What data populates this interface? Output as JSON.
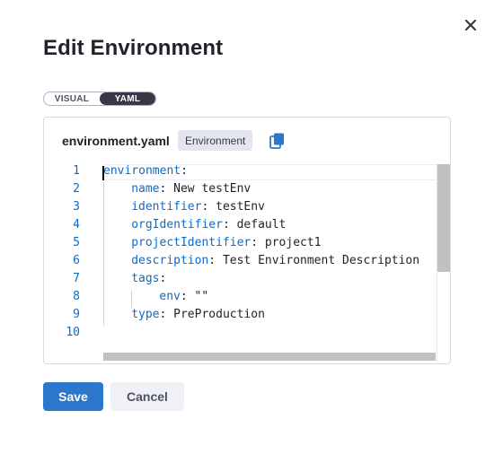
{
  "dialog": {
    "title": "Edit Environment",
    "close_icon": "close-icon"
  },
  "view_toggle": {
    "options": [
      "VISUAL",
      "YAML"
    ],
    "selected": "YAML"
  },
  "editor": {
    "filename": "environment.yaml",
    "badge": "Environment",
    "copy_icon": "copy-icon",
    "lines": [
      {
        "num": "1",
        "indent": 0,
        "key": "environment",
        "value": ""
      },
      {
        "num": "2",
        "indent": 1,
        "key": "name",
        "value": "New testEnv"
      },
      {
        "num": "3",
        "indent": 1,
        "key": "identifier",
        "value": "testEnv"
      },
      {
        "num": "4",
        "indent": 1,
        "key": "orgIdentifier",
        "value": "default"
      },
      {
        "num": "5",
        "indent": 1,
        "key": "projectIdentifier",
        "value": "project1"
      },
      {
        "num": "6",
        "indent": 1,
        "key": "description",
        "value": "Test Environment Description"
      },
      {
        "num": "7",
        "indent": 1,
        "key": "tags",
        "value": ""
      },
      {
        "num": "8",
        "indent": 2,
        "key": "env",
        "value": "\"\""
      },
      {
        "num": "9",
        "indent": 1,
        "key": "type",
        "value": "PreProduction"
      },
      {
        "num": "10",
        "indent": 0,
        "key": "",
        "value": ""
      }
    ]
  },
  "footer": {
    "save_label": "Save",
    "cancel_label": "Cancel"
  },
  "colors": {
    "accent": "#2c76cc",
    "yaml_key": "#0b6bcb",
    "line_number": "#0b6bcb",
    "toggle_active": "#383946"
  }
}
